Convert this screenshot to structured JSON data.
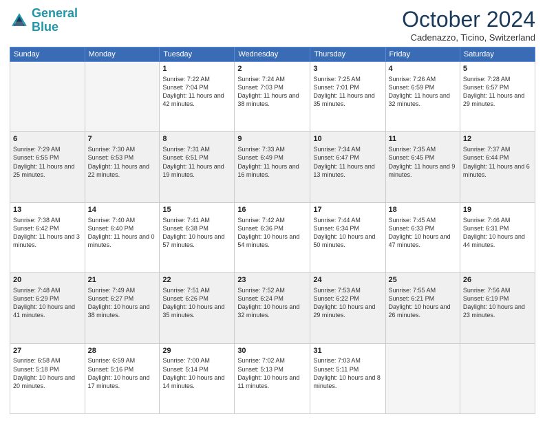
{
  "header": {
    "logo_line1": "General",
    "logo_line2": "Blue",
    "month": "October 2024",
    "location": "Cadenazzo, Ticino, Switzerland"
  },
  "weekdays": [
    "Sunday",
    "Monday",
    "Tuesday",
    "Wednesday",
    "Thursday",
    "Friday",
    "Saturday"
  ],
  "weeks": [
    [
      {
        "day": "",
        "info": ""
      },
      {
        "day": "",
        "info": ""
      },
      {
        "day": "1",
        "info": "Sunrise: 7:22 AM\nSunset: 7:04 PM\nDaylight: 11 hours and 42 minutes."
      },
      {
        "day": "2",
        "info": "Sunrise: 7:24 AM\nSunset: 7:03 PM\nDaylight: 11 hours and 38 minutes."
      },
      {
        "day": "3",
        "info": "Sunrise: 7:25 AM\nSunset: 7:01 PM\nDaylight: 11 hours and 35 minutes."
      },
      {
        "day": "4",
        "info": "Sunrise: 7:26 AM\nSunset: 6:59 PM\nDaylight: 11 hours and 32 minutes."
      },
      {
        "day": "5",
        "info": "Sunrise: 7:28 AM\nSunset: 6:57 PM\nDaylight: 11 hours and 29 minutes."
      }
    ],
    [
      {
        "day": "6",
        "info": "Sunrise: 7:29 AM\nSunset: 6:55 PM\nDaylight: 11 hours and 25 minutes."
      },
      {
        "day": "7",
        "info": "Sunrise: 7:30 AM\nSunset: 6:53 PM\nDaylight: 11 hours and 22 minutes."
      },
      {
        "day": "8",
        "info": "Sunrise: 7:31 AM\nSunset: 6:51 PM\nDaylight: 11 hours and 19 minutes."
      },
      {
        "day": "9",
        "info": "Sunrise: 7:33 AM\nSunset: 6:49 PM\nDaylight: 11 hours and 16 minutes."
      },
      {
        "day": "10",
        "info": "Sunrise: 7:34 AM\nSunset: 6:47 PM\nDaylight: 11 hours and 13 minutes."
      },
      {
        "day": "11",
        "info": "Sunrise: 7:35 AM\nSunset: 6:45 PM\nDaylight: 11 hours and 9 minutes."
      },
      {
        "day": "12",
        "info": "Sunrise: 7:37 AM\nSunset: 6:44 PM\nDaylight: 11 hours and 6 minutes."
      }
    ],
    [
      {
        "day": "13",
        "info": "Sunrise: 7:38 AM\nSunset: 6:42 PM\nDaylight: 11 hours and 3 minutes."
      },
      {
        "day": "14",
        "info": "Sunrise: 7:40 AM\nSunset: 6:40 PM\nDaylight: 11 hours and 0 minutes."
      },
      {
        "day": "15",
        "info": "Sunrise: 7:41 AM\nSunset: 6:38 PM\nDaylight: 10 hours and 57 minutes."
      },
      {
        "day": "16",
        "info": "Sunrise: 7:42 AM\nSunset: 6:36 PM\nDaylight: 10 hours and 54 minutes."
      },
      {
        "day": "17",
        "info": "Sunrise: 7:44 AM\nSunset: 6:34 PM\nDaylight: 10 hours and 50 minutes."
      },
      {
        "day": "18",
        "info": "Sunrise: 7:45 AM\nSunset: 6:33 PM\nDaylight: 10 hours and 47 minutes."
      },
      {
        "day": "19",
        "info": "Sunrise: 7:46 AM\nSunset: 6:31 PM\nDaylight: 10 hours and 44 minutes."
      }
    ],
    [
      {
        "day": "20",
        "info": "Sunrise: 7:48 AM\nSunset: 6:29 PM\nDaylight: 10 hours and 41 minutes."
      },
      {
        "day": "21",
        "info": "Sunrise: 7:49 AM\nSunset: 6:27 PM\nDaylight: 10 hours and 38 minutes."
      },
      {
        "day": "22",
        "info": "Sunrise: 7:51 AM\nSunset: 6:26 PM\nDaylight: 10 hours and 35 minutes."
      },
      {
        "day": "23",
        "info": "Sunrise: 7:52 AM\nSunset: 6:24 PM\nDaylight: 10 hours and 32 minutes."
      },
      {
        "day": "24",
        "info": "Sunrise: 7:53 AM\nSunset: 6:22 PM\nDaylight: 10 hours and 29 minutes."
      },
      {
        "day": "25",
        "info": "Sunrise: 7:55 AM\nSunset: 6:21 PM\nDaylight: 10 hours and 26 minutes."
      },
      {
        "day": "26",
        "info": "Sunrise: 7:56 AM\nSunset: 6:19 PM\nDaylight: 10 hours and 23 minutes."
      }
    ],
    [
      {
        "day": "27",
        "info": "Sunrise: 6:58 AM\nSunset: 5:18 PM\nDaylight: 10 hours and 20 minutes."
      },
      {
        "day": "28",
        "info": "Sunrise: 6:59 AM\nSunset: 5:16 PM\nDaylight: 10 hours and 17 minutes."
      },
      {
        "day": "29",
        "info": "Sunrise: 7:00 AM\nSunset: 5:14 PM\nDaylight: 10 hours and 14 minutes."
      },
      {
        "day": "30",
        "info": "Sunrise: 7:02 AM\nSunset: 5:13 PM\nDaylight: 10 hours and 11 minutes."
      },
      {
        "day": "31",
        "info": "Sunrise: 7:03 AM\nSunset: 5:11 PM\nDaylight: 10 hours and 8 minutes."
      },
      {
        "day": "",
        "info": ""
      },
      {
        "day": "",
        "info": ""
      }
    ]
  ]
}
